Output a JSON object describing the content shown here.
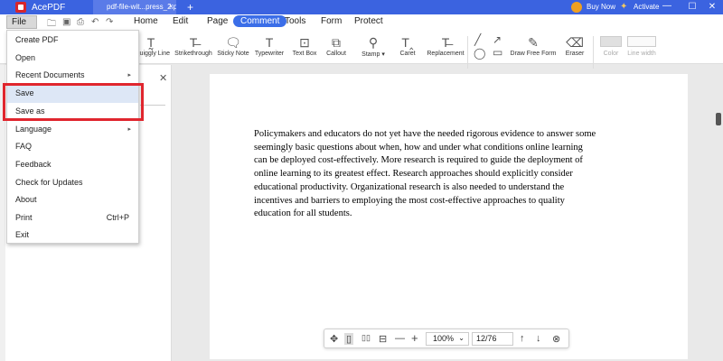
{
  "titlebar": {
    "app_name": "AcePDF",
    "doc_tab": "pdf-file-wit...press_2.pdf*",
    "doc_tab_close": "×",
    "new_tab": "+",
    "buy_now": "Buy Now",
    "activate": "Activate",
    "minimize": "—",
    "maximize": "☐",
    "close": "✕",
    "brand_color": "#3b63e0"
  },
  "toolbar": {
    "file_label": "File",
    "file_caret": "⌄",
    "menu_tabs": [
      "Home",
      "Edit",
      "Page",
      "Comment",
      "Tools",
      "Form",
      "Protect"
    ],
    "active_tab": "Comment",
    "tools": [
      {
        "label": "Squiggly Line",
        "icon": "squiggly-line-icon"
      },
      {
        "label": "Strikethrough",
        "icon": "strikethrough-icon"
      },
      {
        "label": "Sticky Note",
        "icon": "sticky-note-icon"
      },
      {
        "label": "Typewriter",
        "icon": "typewriter-icon"
      },
      {
        "label": "Text Box",
        "icon": "text-box-icon"
      },
      {
        "label": "Callout",
        "icon": "callout-icon"
      },
      {
        "label": "Stamp",
        "icon": "stamp-icon"
      },
      {
        "label": "Caret",
        "icon": "caret-icon"
      },
      {
        "label": "Replacement",
        "icon": "replacement-icon"
      },
      {
        "label": "Draw Free Form",
        "icon": "pencil-icon"
      },
      {
        "label": "Eraser",
        "icon": "eraser-icon"
      },
      {
        "label": "Color",
        "icon": "color-swatch-icon"
      },
      {
        "label": "Line width",
        "icon": "line-width-icon"
      }
    ]
  },
  "file_menu": {
    "items": [
      {
        "label": "Create PDF",
        "has_submenu": false
      },
      {
        "label": "Open",
        "has_submenu": false
      },
      {
        "label": "Recent Documents",
        "has_submenu": true
      },
      {
        "label": "Save",
        "has_submenu": false,
        "highlighted": true
      },
      {
        "label": "Save as",
        "has_submenu": false
      },
      {
        "label": "Language",
        "has_submenu": true
      },
      {
        "label": "FAQ",
        "has_submenu": false
      },
      {
        "label": "Feedback",
        "has_submenu": false
      },
      {
        "label": "Check for Updates",
        "has_submenu": false
      },
      {
        "label": "About",
        "has_submenu": false
      },
      {
        "label": "Print",
        "shortcut": "Ctrl+P"
      },
      {
        "label": "Exit",
        "has_submenu": false
      }
    ],
    "submenu_arrow": "▸",
    "highlight_color": "#e0262e"
  },
  "left_panel": {
    "close": "✕"
  },
  "document": {
    "paragraph": "Policymakers and educators do not yet have the needed rigorous evidence to answer some seemingly basic questions about when, how and under what conditions online learning can be deployed cost-effectively. More research is required to guide the deployment of online learning to its greatest effect. Research approaches should explicitly consider educational productivity. Organizational research is also needed to understand the incentives and barriers to employing the most cost-effective approaches to quality education for all students."
  },
  "nav": {
    "zoom": "100%",
    "zoom_caret": "⌄",
    "page": "12/76",
    "icons": {
      "move": "✥",
      "single_page": "▯",
      "two_page": "▯▯",
      "fit": "⊟",
      "zoom_out": "—",
      "zoom_in": "+",
      "prev": "↑",
      "next": "↓",
      "close": "⊗"
    }
  }
}
